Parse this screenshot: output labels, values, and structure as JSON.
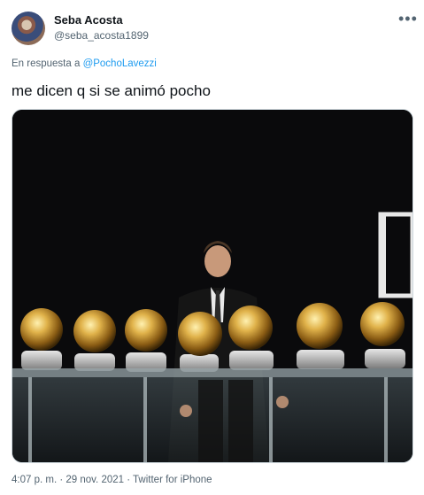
{
  "author": {
    "name": "Seba Acosta",
    "handle": "@seba_acosta1899"
  },
  "reply": {
    "prefix": "En respuesta a",
    "mention": "@PochoLavezzi"
  },
  "tweet_text": "me dicen q si se animó pocho",
  "icons": {
    "more": "more-options-icon"
  },
  "meta": {
    "time": "4:07 p. m.",
    "separator1": " · ",
    "date": "29 nov. 2021",
    "separator2": " · ",
    "source": "Twitter for iPhone"
  },
  "colors": {
    "link": "#1d9bf0",
    "secondary_text": "#536471",
    "primary_text": "#0f1419"
  }
}
